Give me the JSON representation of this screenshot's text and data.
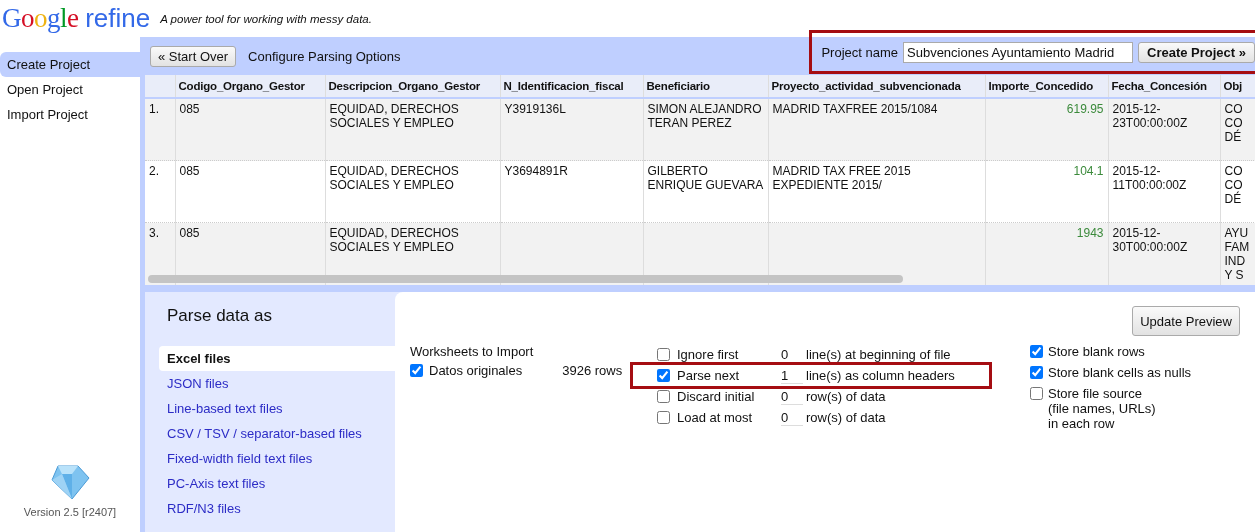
{
  "header": {
    "logo": "Google",
    "product": "refine",
    "tagline": "A power tool for working with messy data."
  },
  "sidebar": {
    "items": [
      {
        "label": "Create Project",
        "selected": true
      },
      {
        "label": "Open Project",
        "selected": false
      },
      {
        "label": "Import Project",
        "selected": false
      }
    ],
    "version": "Version 2.5 [r2407]"
  },
  "toolbar": {
    "start_over": "« Start Over",
    "title": "Configure Parsing Options",
    "project_name_label": "Project name",
    "project_name_value": "Subvenciones Ayuntamiento Madrid",
    "create_button": "Create Project »",
    "highlighted": true
  },
  "preview": {
    "columns": [
      {
        "label": "Codigo_Organo_Gestor",
        "kind": "text"
      },
      {
        "label": "Descripcion_Organo_Gestor",
        "kind": "text"
      },
      {
        "label": "N_Identificacion_fiscal",
        "kind": "text"
      },
      {
        "label": "Beneficiario",
        "kind": "text"
      },
      {
        "label": "Proyecto_actividad_subvencionada",
        "kind": "text"
      },
      {
        "label": "Importe_Concedido",
        "kind": "number"
      },
      {
        "label": "Fecha_Concesión",
        "kind": "text"
      },
      {
        "label": "Obj",
        "kind": "cut"
      }
    ],
    "rows": [
      {
        "number": "1.",
        "cells": [
          "085",
          "EQUIDAD, DERECHOS SOCIALES Y EMPLEO",
          "Y3919136L",
          "SIMON ALEJANDRO TERAN PEREZ",
          "MADRID TAXFREE 2015/1084",
          "619.95",
          "2015-12-23T00:00:00Z",
          "CO\nCO\nDÉ"
        ]
      },
      {
        "number": "2.",
        "cells": [
          "085",
          "EQUIDAD, DERECHOS SOCIALES Y EMPLEO",
          "Y3694891R",
          "GILBERTO ENRIQUE GUEVARA",
          "MADRID TAX FREE 2015 EXPEDIENTE 2015/",
          "104.1",
          "2015-12-11T00:00:00Z",
          "CO\nCO\nDÉ"
        ]
      },
      {
        "number": "3.",
        "cells": [
          "085",
          "EQUIDAD, DERECHOS SOCIALES Y EMPLEO",
          "",
          "",
          "",
          "1943",
          "2015-12-30T00:00:00Z",
          "AYU\nFAM\nIND\nY S"
        ]
      }
    ]
  },
  "parse": {
    "title": "Parse data as",
    "formats": [
      {
        "label": "Excel files",
        "selected": true
      },
      {
        "label": "JSON files",
        "selected": false
      },
      {
        "label": "Line-based text files",
        "selected": false
      },
      {
        "label": "CSV / TSV / separator-based files",
        "selected": false
      },
      {
        "label": "Fixed-width field text files",
        "selected": false
      },
      {
        "label": "PC-Axis text files",
        "selected": false
      },
      {
        "label": "RDF/N3 files",
        "selected": false
      }
    ],
    "update_button": "Update Preview",
    "worksheets_label": "Worksheets to Import",
    "worksheets": [
      {
        "name": "Datos originales",
        "rows": "3926 rows",
        "checked": true
      }
    ],
    "options": [
      {
        "label": "Ignore first",
        "value": "0",
        "suffix": "line(s) at beginning of file",
        "checked": false,
        "highlighted": false
      },
      {
        "label": "Parse next",
        "value": "1",
        "suffix": "line(s) as column headers",
        "checked": true,
        "highlighted": true
      },
      {
        "label": "Discard initial",
        "value": "0",
        "suffix": "row(s) of data",
        "checked": false,
        "highlighted": false
      },
      {
        "label": "Load at most",
        "value": "0",
        "suffix": "row(s) of data",
        "checked": false,
        "highlighted": false
      }
    ],
    "store_options": [
      {
        "label": "Store blank rows",
        "checked": true
      },
      {
        "label": "Store blank cells as nulls",
        "checked": true
      },
      {
        "label": "Store file source\n(file names, URLs)\nin each row",
        "checked": false
      }
    ]
  }
}
